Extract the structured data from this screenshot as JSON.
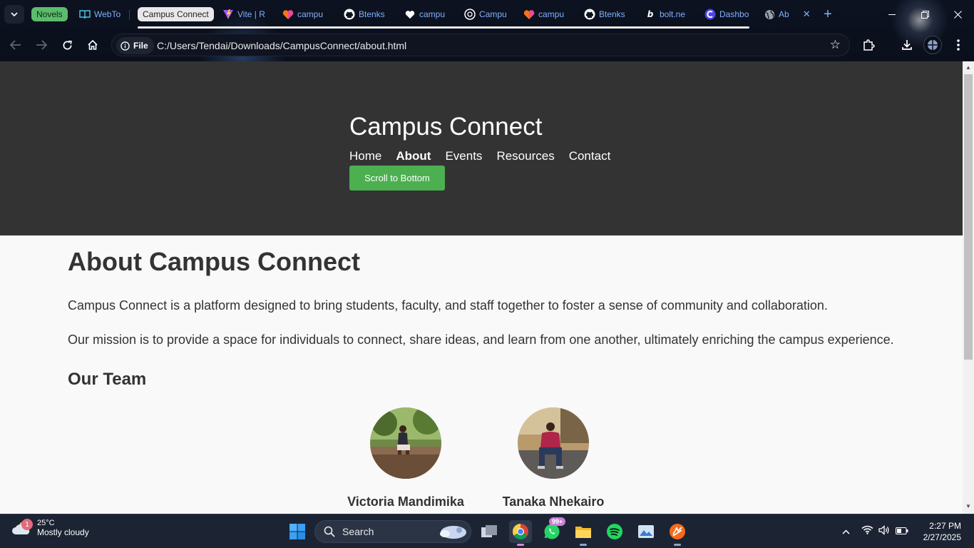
{
  "browser": {
    "tabs": [
      {
        "label": "Novels",
        "kind": "group"
      },
      {
        "label": "WebTo",
        "icon": "book-icon"
      },
      {
        "label": "Campus Connect",
        "kind": "group"
      },
      {
        "label": "Vite | R",
        "icon": "vite-icon"
      },
      {
        "label": "campu",
        "icon": "heart-icon"
      },
      {
        "label": "Btenks",
        "icon": "github-icon"
      },
      {
        "label": "campu",
        "icon": "heart-icon"
      },
      {
        "label": "Campu",
        "icon": "chatgpt-icon"
      },
      {
        "label": "campu",
        "icon": "heart-icon"
      },
      {
        "label": "Btenks",
        "icon": "github-icon"
      },
      {
        "label": "bolt.ne",
        "icon": "bolt-icon"
      },
      {
        "label": "Dashbo",
        "icon": "dashboard-icon"
      },
      {
        "label": "Ab",
        "icon": "globe-icon"
      }
    ],
    "site_chip": "File",
    "url": "C:/Users/Tendai/Downloads/CampusConnect/about.html"
  },
  "site": {
    "title": "Campus Connect",
    "nav": [
      "Home",
      "About",
      "Events",
      "Resources",
      "Contact"
    ],
    "active_nav": "About",
    "scroll_button": "Scroll to Bottom"
  },
  "about": {
    "heading": "About Campus Connect",
    "paragraph1": "Campus Connect is a platform designed to bring students, faculty, and staff together to foster a sense of community and collaboration.",
    "paragraph2": "Our mission is to provide a space for individuals to connect, share ideas, and learn from one another, ultimately enriching the campus experience.",
    "team_heading": "Our Team",
    "team": [
      {
        "name": "Victoria Mandimika"
      },
      {
        "name": "Tanaka Nhekairo"
      }
    ]
  },
  "taskbar": {
    "weather_badge": "1",
    "temperature": "25°C",
    "condition": "Mostly cloudy",
    "search_label": "Search",
    "whatsapp_badge": "99+",
    "time": "2:27 PM",
    "date": "2/27/2025"
  },
  "colors": {
    "header_bg": "#333333",
    "button_green": "#4caf50",
    "page_bg": "#f9f9f9"
  }
}
